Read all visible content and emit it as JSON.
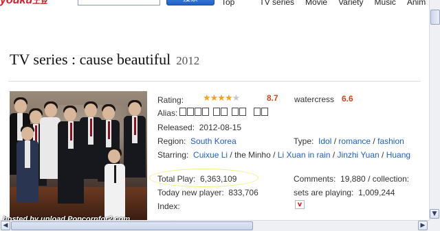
{
  "header": {
    "logo": "youku",
    "logo_tail": "土豆",
    "search_button": "搜索",
    "nav": [
      "Top",
      "TV series",
      "Movie",
      "Variety",
      "Music",
      "Animation"
    ]
  },
  "title": {
    "text": "TV series : cause beautiful",
    "year": "2012"
  },
  "info": {
    "rating_label": "Rating:",
    "stars": "★★★★",
    "half_star": "★",
    "rating_value": "8.7",
    "watercress_label": "watercress",
    "watercress_value": "6.6",
    "alias_label": "Alias:",
    "released_label": "Released:",
    "released_value": "2012-08-15",
    "region_label": "Region:",
    "region_value": "South Korea",
    "type_label": "Type:",
    "type_values": [
      "Idol",
      "romance",
      "fashion"
    ],
    "starring_label": "Starring:",
    "starring_values": [
      "Cuixue Li",
      "the Minho",
      "Li Xuan in rain",
      "Jinzhi Yuan",
      "Huang"
    ],
    "total_play_label": "Total Play:",
    "total_play_value": "6,363,109",
    "comments_label": "Comments:",
    "comments_value": "19,880 / collection:",
    "today_label": "Today new player:",
    "today_value": "833,706",
    "sets_label": "sets are playing:",
    "sets_value": "1,009,244",
    "index_label": "Index:",
    "index_icon": "v"
  },
  "poster": {
    "watermark": "hosted by upload.Popcornfor2.com"
  },
  "colors": {
    "link": "#1f5fc2",
    "score": "#d0451b",
    "star": "#f4a31c",
    "highlight": "#f2ee7a"
  },
  "scrollbar": {
    "up": "▲",
    "down": "▼",
    "left": "◀",
    "right": "▶"
  }
}
